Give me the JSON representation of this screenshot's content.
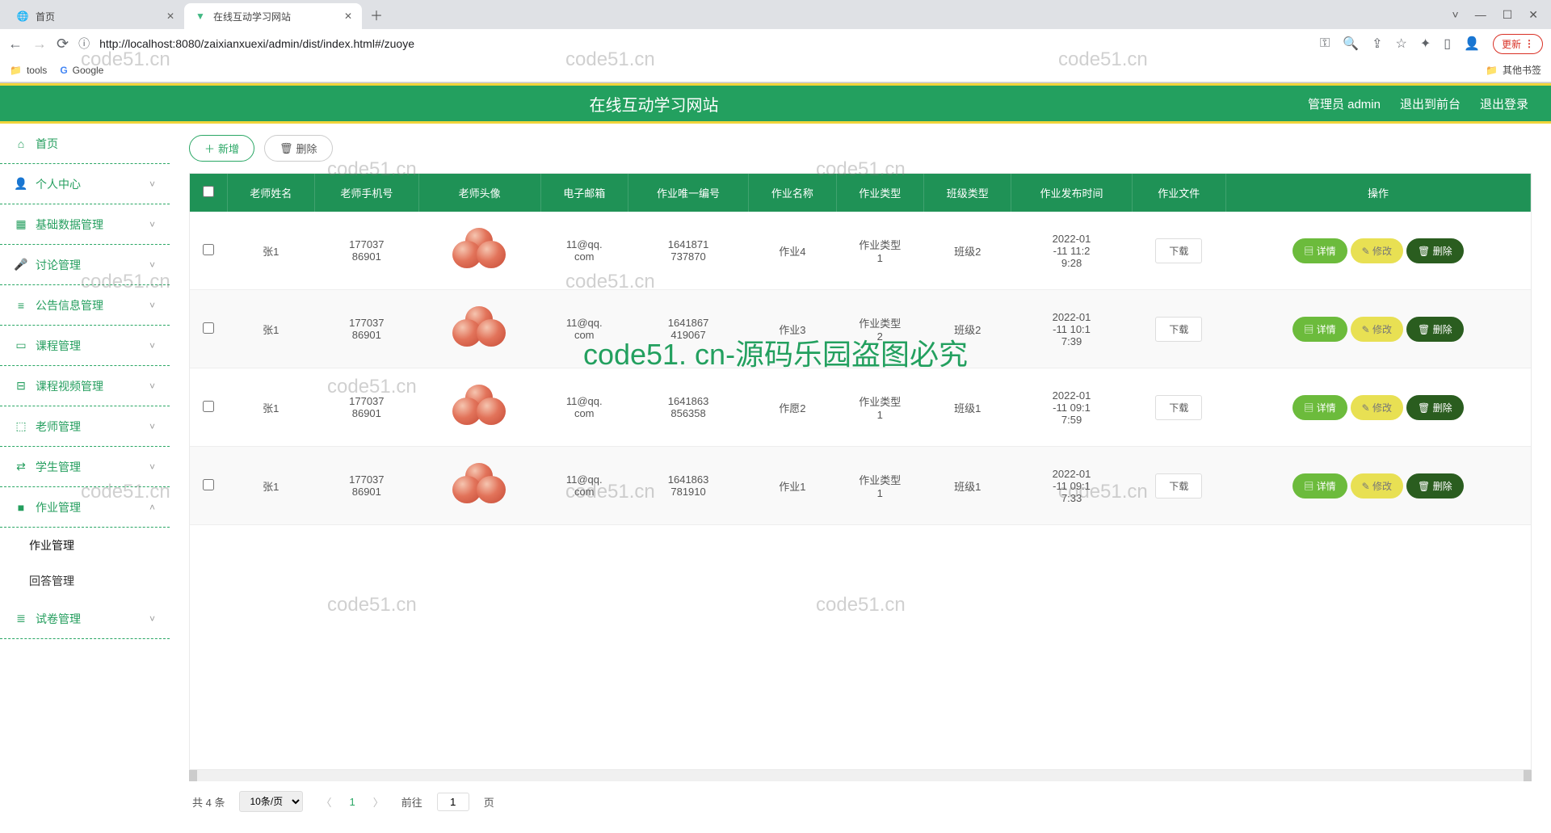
{
  "browser": {
    "tabs": [
      {
        "title": "首页",
        "active": false
      },
      {
        "title": "在线互动学习网站",
        "active": true
      }
    ],
    "url": "http://localhost:8080/zaixianxuexi/admin/dist/index.html#/zuoye",
    "update_label": "更新",
    "bookmarks": {
      "tools": "tools",
      "google": "Google",
      "other": "其他书签"
    },
    "win": {
      "min": "—",
      "max": "☐",
      "close": "✕",
      "drop": "˅"
    }
  },
  "header": {
    "title": "在线互动学习网站",
    "admin": "管理员 admin",
    "to_front": "退出到前台",
    "logout": "退出登录"
  },
  "sidebar": {
    "items": [
      {
        "icon": "⌂",
        "label": "首页",
        "expandable": false
      },
      {
        "icon": "👤",
        "label": "个人中心",
        "expandable": true
      },
      {
        "icon": "▦",
        "label": "基础数据管理",
        "expandable": true
      },
      {
        "icon": "🎤",
        "label": "讨论管理",
        "expandable": true
      },
      {
        "icon": "≡",
        "label": "公告信息管理",
        "expandable": true
      },
      {
        "icon": "▭",
        "label": "课程管理",
        "expandable": true
      },
      {
        "icon": "⊟",
        "label": "课程视频管理",
        "expandable": true
      },
      {
        "icon": "⬚",
        "label": "老师管理",
        "expandable": true
      },
      {
        "icon": "⇄",
        "label": "学生管理",
        "expandable": true
      },
      {
        "icon": "■",
        "label": "作业管理",
        "expandable": true,
        "expanded": true,
        "children": [
          "作业管理",
          "回答管理"
        ]
      },
      {
        "icon": "≣",
        "label": "试卷管理",
        "expandable": true
      }
    ]
  },
  "actions": {
    "add": "新增",
    "delete": "删除"
  },
  "table": {
    "headers": [
      "",
      "老师姓名",
      "老师手机号",
      "老师头像",
      "电子邮箱",
      "作业唯一编号",
      "作业名称",
      "作业类型",
      "班级类型",
      "作业发布时间",
      "作业文件",
      "操作"
    ],
    "download": "下载",
    "ops": {
      "detail": "详情",
      "edit": "修改",
      "del": "删除"
    },
    "rows": [
      {
        "name": "张1",
        "phone": "177037\n86901",
        "email": "11@qq.\ncom",
        "uuid": "1641871\n737870",
        "hwname": "作业4",
        "hwtype": "作业类型\n1",
        "class": "班级2",
        "time": "2022-01\n-11 11:2\n9:28"
      },
      {
        "name": "张1",
        "phone": "177037\n86901",
        "email": "11@qq.\ncom",
        "uuid": "1641867\n419067",
        "hwname": "作业3",
        "hwtype": "作业类型\n2",
        "class": "班级2",
        "time": "2022-01\n-11 10:1\n7:39"
      },
      {
        "name": "张1",
        "phone": "177037\n86901",
        "email": "11@qq.\ncom",
        "uuid": "1641863\n856358",
        "hwname": "作愿2",
        "hwtype": "作业类型\n1",
        "class": "班级1",
        "time": "2022-01\n-11 09:1\n7:59"
      },
      {
        "name": "张1",
        "phone": "177037\n86901",
        "email": "11@qq.\ncom",
        "uuid": "1641863\n781910",
        "hwname": "作业1",
        "hwtype": "作业类型\n1",
        "class": "班级1",
        "time": "2022-01\n-11 09:1\n7:33"
      }
    ]
  },
  "pagination": {
    "total_label": "共 4 条",
    "per_page": "10条/页",
    "current": "1",
    "goto_label": "前往",
    "page_suffix": "页",
    "goto_value": "1"
  },
  "watermarks": {
    "small": "code51.cn",
    "big": "code51. cn-源码乐园盗图必究"
  }
}
